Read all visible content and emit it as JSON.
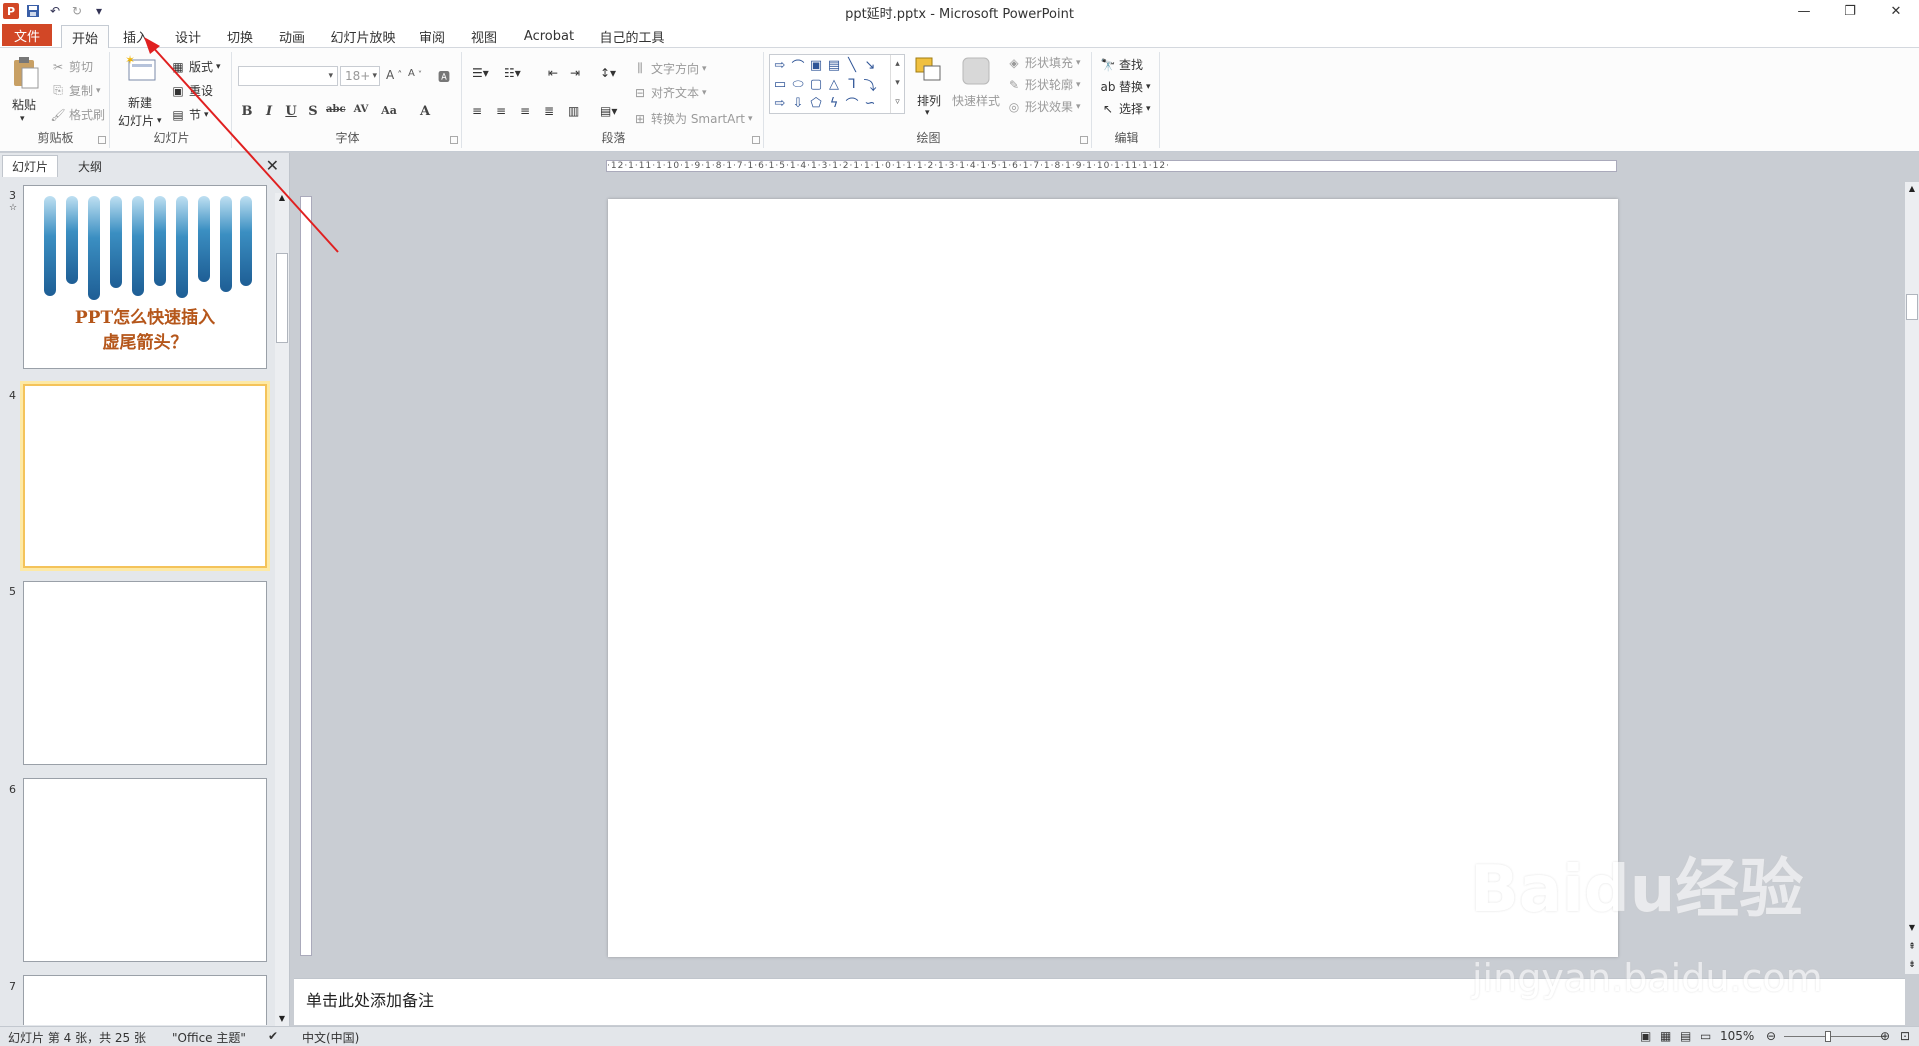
{
  "window": {
    "title": "ppt延时.pptx - Microsoft PowerPoint"
  },
  "tabs": [
    "文件",
    "开始",
    "插入",
    "设计",
    "切换",
    "动画",
    "幻灯片放映",
    "审阅",
    "视图",
    "Acrobat",
    "自己的工具"
  ],
  "ribbon": {
    "clipboard": {
      "label": "剪贴板",
      "paste": "粘贴",
      "cut": "剪切",
      "copy": "复制",
      "format_painter": "格式刷"
    },
    "slides": {
      "label": "幻灯片",
      "new_slide_1": "新建",
      "new_slide_2": "幻灯片",
      "layout": "版式",
      "reset": "重设",
      "section": "节"
    },
    "font": {
      "label": "字体",
      "size": "18+"
    },
    "paragraph": {
      "label": "段落",
      "text_direction": "文字方向",
      "align_text": "对齐文本",
      "smartart": "转换为 SmartArt"
    },
    "drawing": {
      "label": "绘图",
      "arrange": "排列",
      "quick_styles": "快速样式",
      "fill": "形状填充",
      "outline": "形状轮廓",
      "effects": "形状效果"
    },
    "editing": {
      "label": "编辑",
      "find": "查找",
      "replace": "替换",
      "select": "选择"
    }
  },
  "panel": {
    "tab_slides": "幻灯片",
    "tab_outline": "大纲"
  },
  "thumbnails": [
    {
      "num": "3",
      "title": "PPT怎么快速插入",
      "title2": "虚尾箭头？"
    },
    {
      "num": "4"
    },
    {
      "num": "5"
    },
    {
      "num": "6"
    },
    {
      "num": "7"
    }
  ],
  "ruler": {
    "h": "·12·1·11·1·10·1·9·1·8·1·7·1·6·1·5·1·4·1·3·1·2·1·1·1·0·1·1·1·2·1·3·1·4·1·5·1·6·1·7·1·8·1·9·1·10·1·11·1·12·"
  },
  "notes": {
    "placeholder": "单击此处添加备注"
  },
  "status": {
    "slide_info": "幻灯片 第 4 张，共 25 张",
    "theme": "\"Office 主题\"",
    "language": "中文(中国)",
    "zoom": "105%"
  },
  "watermark": {
    "brand": "Baidu经验",
    "url": "jingyan.baidu.com"
  },
  "colors": {
    "file_tab": "#d24726",
    "annotation_arrow": "#e02020",
    "thumb_title": "#b5561a"
  }
}
